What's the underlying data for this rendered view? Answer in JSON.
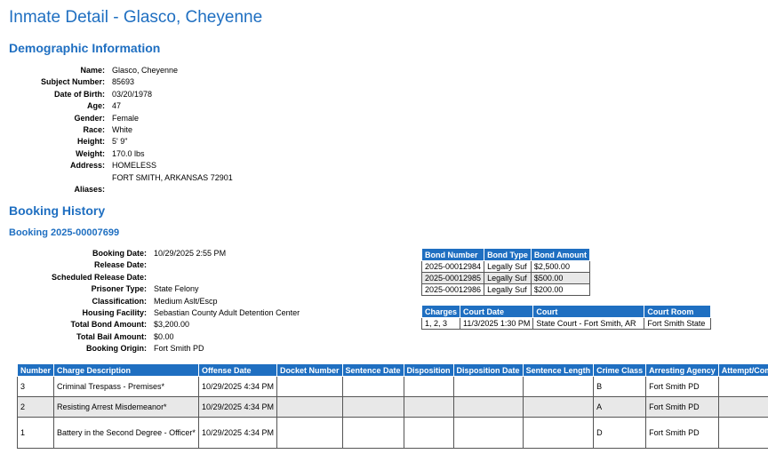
{
  "page_title": "Inmate Detail - Glasco, Cheyenne",
  "demographics": {
    "heading": "Demographic Information",
    "fields": [
      {
        "label": "Name:",
        "value": "Glasco, Cheyenne"
      },
      {
        "label": "Subject Number:",
        "value": "85693"
      },
      {
        "label": "Date of Birth:",
        "value": "03/20/1978"
      },
      {
        "label": "Age:",
        "value": "47"
      },
      {
        "label": "Gender:",
        "value": "Female"
      },
      {
        "label": "Race:",
        "value": "White"
      },
      {
        "label": "Height:",
        "value": "5' 9\""
      },
      {
        "label": "Weight:",
        "value": "170.0 lbs"
      },
      {
        "label": "Address:",
        "value": "HOMELESS",
        "value2": "FORT SMITH, ARKANSAS 72901"
      },
      {
        "label": "Aliases:",
        "value": ""
      }
    ]
  },
  "booking_history": {
    "heading": "Booking History",
    "booking_heading": "Booking 2025-00007699",
    "fields": [
      {
        "label": "Booking Date:",
        "value": "10/29/2025 2:55 PM"
      },
      {
        "label": "Release Date:",
        "value": ""
      },
      {
        "label": "Scheduled Release Date:",
        "value": ""
      },
      {
        "label": "Prisoner Type:",
        "value": "State Felony"
      },
      {
        "label": "Classification:",
        "value": "Medium Aslt/Escp"
      },
      {
        "label": "Housing Facility:",
        "value": "Sebastian County Adult Detention Center"
      },
      {
        "label": "Total Bond Amount:",
        "value": "$3,200.00"
      },
      {
        "label": "Total Bail Amount:",
        "value": "$0.00"
      },
      {
        "label": "Booking Origin:",
        "value": "Fort Smith PD"
      }
    ],
    "bonds": {
      "headers": [
        "Bond Number",
        "Bond Type",
        "Bond Amount"
      ],
      "rows": [
        [
          "2025-00012984",
          "Legally Suf",
          "$2,500.00"
        ],
        [
          "2025-00012985",
          "Legally Suf",
          "$500.00"
        ],
        [
          "2025-00012986",
          "Legally Suf",
          "$200.00"
        ]
      ]
    },
    "court": {
      "headers": [
        "Charges",
        "Court Date",
        "Court",
        "Court Room"
      ],
      "rows": [
        [
          "1, 2, 3",
          "11/3/2025 1:30 PM",
          "State Court - Fort Smith, AR",
          "Fort Smith State"
        ]
      ]
    },
    "charges": {
      "headers": [
        "Number",
        "Charge Description",
        "Offense Date",
        "Docket Number",
        "Sentence Date",
        "Disposition",
        "Disposition Date",
        "Sentence Length",
        "Crime Class",
        "Arresting Agency",
        "Attempt/Commit"
      ],
      "rows": [
        [
          "3",
          "Criminal Trespass - Premises*",
          "10/29/2025 4:34 PM",
          "",
          "",
          "",
          "",
          "",
          "B",
          "Fort Smith PD",
          ""
        ],
        [
          "2",
          "Resisting Arrest Misdemeanor*",
          "10/29/2025 4:34 PM",
          "",
          "",
          "",
          "",
          "",
          "A",
          "Fort Smith PD",
          ""
        ],
        [
          "1",
          "Battery in the Second Degree - Officer*",
          "10/29/2025 4:34 PM",
          "",
          "",
          "",
          "",
          "",
          "D",
          "Fort Smith PD",
          ""
        ]
      ]
    }
  }
}
